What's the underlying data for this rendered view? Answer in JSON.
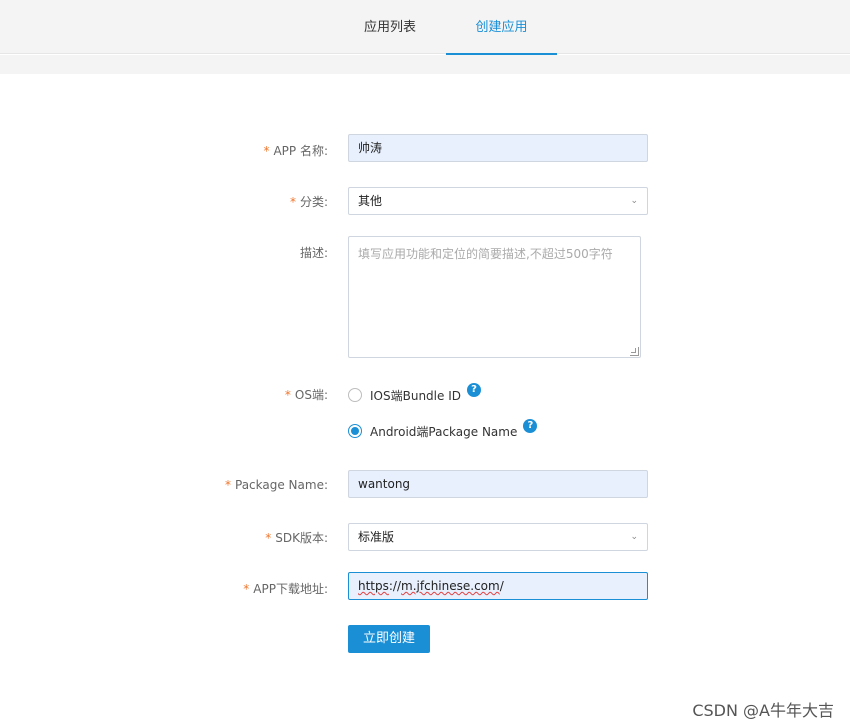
{
  "tabs": {
    "list": "应用列表",
    "create": "创建应用"
  },
  "form": {
    "required_mark": "*",
    "app_name": {
      "label": "APP 名称:",
      "value": "帅涛"
    },
    "category": {
      "label": "分类:",
      "value": "其他"
    },
    "description": {
      "label": "描述:",
      "placeholder": "填写应用功能和定位的简要描述,不超过500字符"
    },
    "os": {
      "label": "OS端:",
      "options": [
        {
          "label": "IOS端Bundle ID",
          "selected": false
        },
        {
          "label": "Android端Package Name",
          "selected": true
        }
      ],
      "help_glyph": "?"
    },
    "package_name": {
      "label": "Package Name:",
      "value": "wantong"
    },
    "sdk_version": {
      "label": "SDK版本:",
      "value": "标准版"
    },
    "download_url": {
      "label": "APP下载地址:",
      "value_prefix": "https",
      "value_mid": "://",
      "value_domain": "m.jfchinese.com",
      "value_suffix": "/"
    },
    "submit_label": "立即创建"
  },
  "watermark": "CSDN @A牛年大吉",
  "colors": {
    "accent": "#1b8fd6",
    "required": "#f0762d",
    "autofill_bg": "#e8f0fe"
  }
}
